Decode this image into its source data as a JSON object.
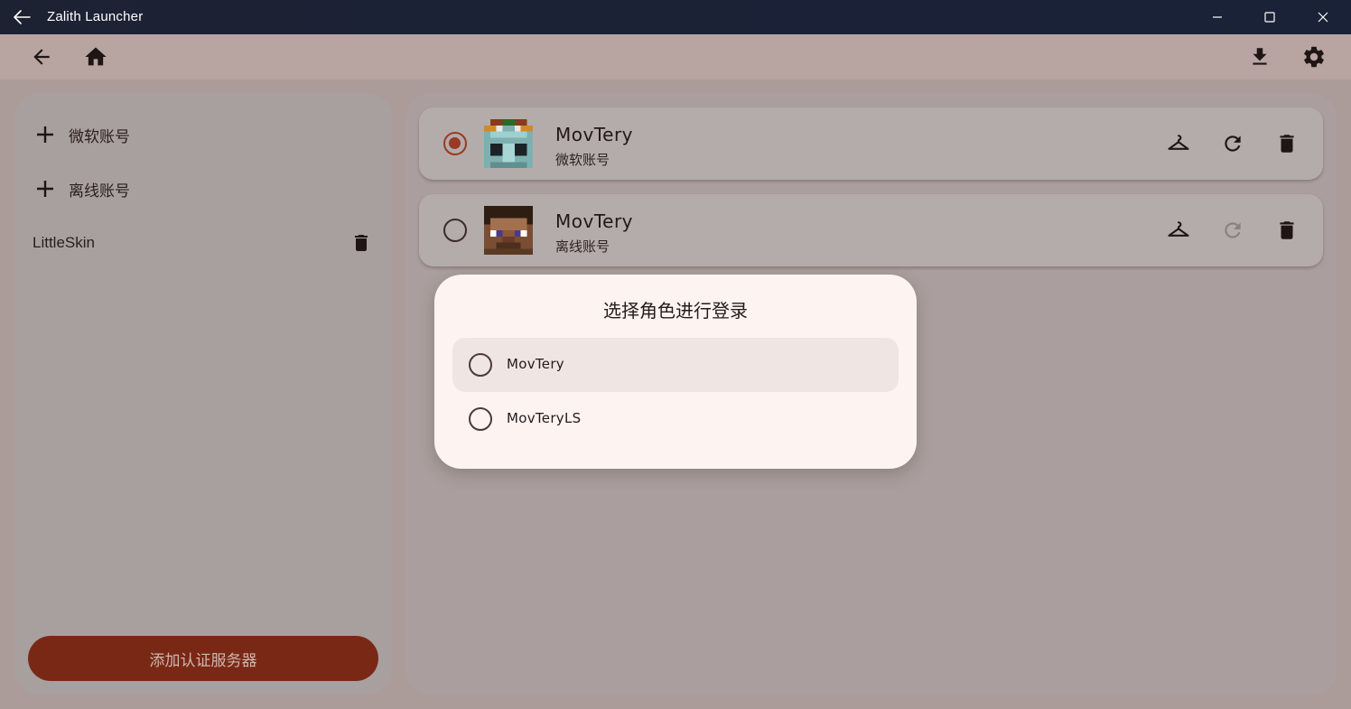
{
  "window": {
    "title": "Zalith Launcher",
    "accent": "#7a2816"
  },
  "sidebar": {
    "items": [
      {
        "label": "微软账号",
        "icon": "plus-icon"
      },
      {
        "label": "离线账号",
        "icon": "plus-icon"
      }
    ],
    "servers": [
      {
        "label": "LittleSkin",
        "icon": "trash-icon"
      }
    ],
    "add_server_label": "添加认证服务器"
  },
  "accounts": [
    {
      "name": "MovTery",
      "type": "微软账号",
      "selected": true,
      "refresh_enabled": true
    },
    {
      "name": "MovTery",
      "type": "离线账号",
      "selected": false,
      "refresh_enabled": false
    }
  ],
  "dialog": {
    "title": "选择角色进行登录",
    "options": [
      {
        "label": "MovTery",
        "highlighted": true
      },
      {
        "label": "MovTeryLS",
        "highlighted": false
      }
    ]
  }
}
